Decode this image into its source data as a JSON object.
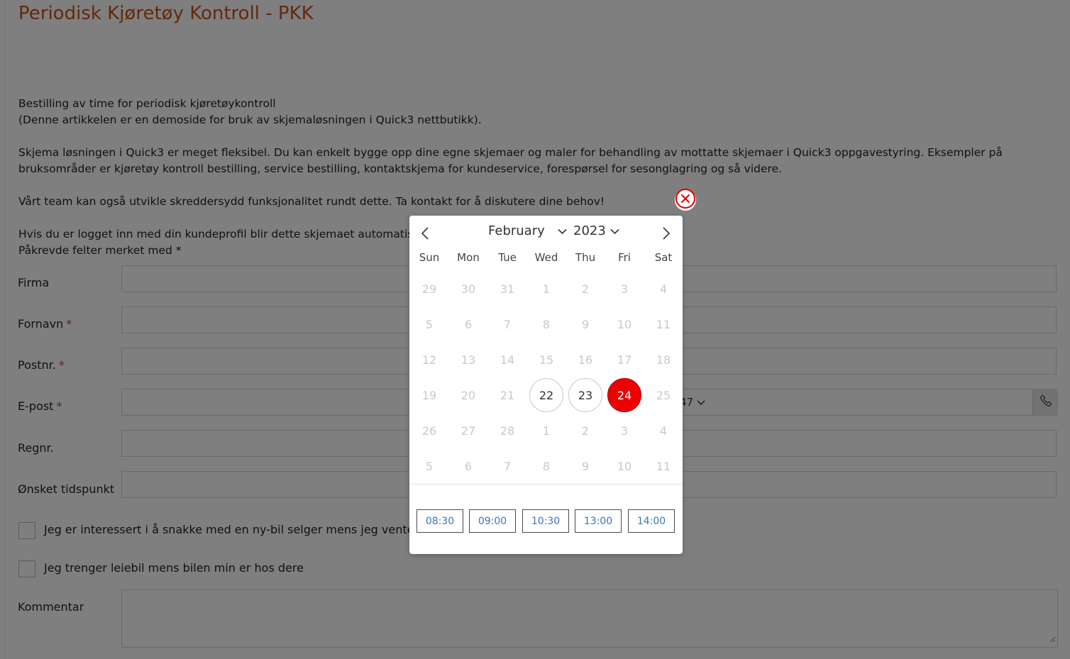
{
  "page": {
    "title": "Periodisk Kjøretøy Kontroll - PKK",
    "intro_line1": "Bestilling av time for periodisk kjøretøykontroll",
    "intro_line2": "(Denne artikkelen er en demoside for bruk av skjemaløsningen i Quick3 nettbutikk).",
    "description": "Skjema løsningen i Quick3 er meget fleksibel. Du kan enkelt bygge opp dine egne skjemaer og maler for behandling av mottatte skjemaer i Quick3 oppgavestyring. Eksempler på bruksområder er kjøretøy kontroll bestilling, service bestilling, kontaktskjema for kundeservice, forespørsel for sesonglagring og så videre.",
    "team_note": "Vårt team kan også utvikle skreddersydd funksjonalitet rundt dette. Ta kontakt for å diskutere dine behov!",
    "login_note": "Hvis du er logget inn med din kundeprofil blir dette skjemaet automatisk u",
    "required_note": "Påkrevde felter merket med *"
  },
  "form": {
    "required_marker": "*",
    "fields": [
      {
        "label": "Firma",
        "required": false
      },
      {
        "label": "Fornavn",
        "required": true
      },
      {
        "label": "Postnr.",
        "required": true
      },
      {
        "label": "E-post",
        "required": true
      },
      {
        "label": "Regnr.",
        "required": false
      },
      {
        "label": "Ønsket tidspunkt",
        "required": false
      }
    ],
    "phone_country_code": "47",
    "checkboxes": [
      {
        "label": "Jeg er interessert i å snakke med en ny-bil selger mens jeg venter",
        "checked": false
      },
      {
        "label": "Jeg trenger leiebil mens bilen min er hos dere",
        "checked": false
      }
    ],
    "comment_label": "Kommentar"
  },
  "calendar": {
    "month": "February",
    "year": "2023",
    "weekdays": [
      "Sun",
      "Mon",
      "Tue",
      "Wed",
      "Thu",
      "Fri",
      "Sat"
    ],
    "weeks": [
      [
        "29",
        "30",
        "31",
        "1",
        "2",
        "3",
        "4"
      ],
      [
        "5",
        "6",
        "7",
        "8",
        "9",
        "10",
        "11"
      ],
      [
        "12",
        "13",
        "14",
        "15",
        "16",
        "17",
        "18"
      ],
      [
        "19",
        "20",
        "21",
        "22",
        "23",
        "24",
        "25"
      ],
      [
        "26",
        "27",
        "28",
        "1",
        "2",
        "3",
        "4"
      ],
      [
        "5",
        "6",
        "7",
        "8",
        "9",
        "10",
        "11"
      ]
    ],
    "available_days": [
      "22",
      "23"
    ],
    "selected_day": "24",
    "time_slots": [
      "08:30",
      "09:00",
      "10:30",
      "13:00",
      "14:00"
    ],
    "accent_color": "#ee0000",
    "time_text_color": "#3a78b5"
  },
  "icons": {
    "close": "close-circle-icon",
    "prev": "chevron-left-icon",
    "next": "chevron-right-icon",
    "dropdown": "chevron-down-icon",
    "phone": "phone-icon"
  },
  "colors": {
    "title": "#c8531a",
    "required": "#c0392b"
  }
}
